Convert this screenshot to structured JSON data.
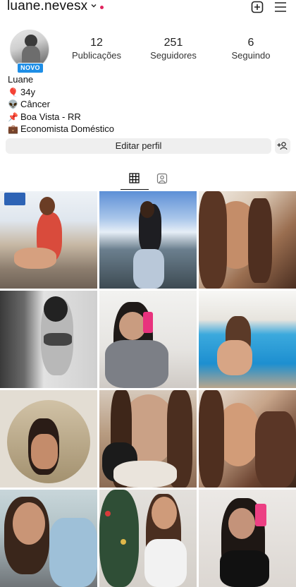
{
  "header": {
    "username": "luane.nevesx",
    "has_notification": true
  },
  "profile": {
    "badge": "NOVO",
    "stats": [
      {
        "value": "12",
        "label": "Publicações"
      },
      {
        "value": "251",
        "label": "Seguidores"
      },
      {
        "value": "6",
        "label": "Seguindo"
      }
    ],
    "name": "Luane",
    "bio": [
      {
        "icon": "balloon-icon",
        "emoji": "🎈",
        "text": "34y"
      },
      {
        "icon": "alien-icon",
        "emoji": "👽",
        "text": "Câncer"
      },
      {
        "icon": "pushpin-icon",
        "emoji": "📌",
        "text": "Boa Vista - RR"
      },
      {
        "icon": "briefcase-icon",
        "emoji": "💼",
        "text": "Economista Doméstico"
      }
    ]
  },
  "actions": {
    "edit_label": "Editar perfil"
  },
  "tabs": [
    {
      "icon": "grid-icon",
      "active": true
    },
    {
      "icon": "tagged-icon",
      "active": false
    }
  ],
  "posts": [
    {
      "icon": "photo-red-swimsuit"
    },
    {
      "icon": "photo-lake-jeans"
    },
    {
      "icon": "photo-selfie-closeup"
    },
    {
      "icon": "photo-bw-bikini"
    },
    {
      "icon": "photo-mirror-selfie-pink-phone"
    },
    {
      "icon": "photo-pool"
    },
    {
      "icon": "photo-oval-mirror"
    },
    {
      "icon": "photo-with-cat"
    },
    {
      "icon": "photo-lying-portrait"
    },
    {
      "icon": "photo-car-selfie"
    },
    {
      "icon": "photo-christmas-tree"
    },
    {
      "icon": "photo-mirror-selfie-dark"
    }
  ]
}
